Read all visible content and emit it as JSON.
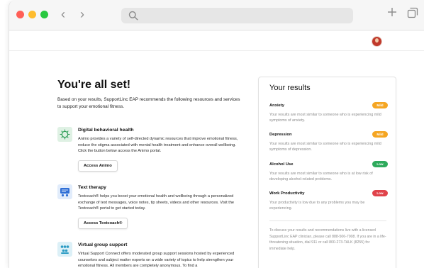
{
  "browser": {
    "icons": [
      "search-icon",
      "plus-icon",
      "tabs-icon",
      "back-icon",
      "forward-icon"
    ]
  },
  "main": {
    "title": "You're all set!",
    "intro": "Based on your results, SupportLinc EAP recommends the following resources and services to support your emotional fitness.",
    "resources": [
      {
        "title": "Digital behavioral health",
        "description": "Animo provides a variety of self-directed dynamic resources that improve emotional fitness, reduce the stigma associated with mental health treatment and enhance overall wellbeing. Click the button below access the Animo portal.",
        "button": "Access Animo",
        "icon": "brain-icon",
        "icon_bg": "#dff1e4",
        "icon_color": "#2e9d57"
      },
      {
        "title": "Text therapy",
        "description": "Textcoach® helps you boost your emotional health and wellbeing through a personalized exchange of text messages, voice notes, tip sheets, videos and other resources. Visit the Textcoach® portal to get started today.",
        "button": "Access Textcoach®",
        "icon": "chat-users-icon",
        "icon_bg": "#e1ecfb",
        "icon_color": "#2f6fd6"
      },
      {
        "title": "Virtual group support",
        "description": "Virtual Support Connect offers moderated group support sessions hosted by experienced counselors and subject matter experts on a wide variety of topics to help strengthen your emotional fitness. All members are completely anonymous. To find a",
        "icon": "group-icon",
        "icon_bg": "#dcf0f7",
        "icon_color": "#2b9bc4"
      }
    ]
  },
  "results": {
    "title": "Your results",
    "items": [
      {
        "name": "Anxiety",
        "badge": "Mild",
        "badge_bg": "#f5a623",
        "badge_fg": "#ffffff",
        "description": "Your results are most similar to someone who is experiencing mild symptoms of anxiety."
      },
      {
        "name": "Depression",
        "badge": "Mild",
        "badge_bg": "#f5a623",
        "badge_fg": "#ffffff",
        "description": "Your results are most similar to someone who is experiencing mild symptoms of depression."
      },
      {
        "name": "Alcohol Use",
        "badge": "Low",
        "badge_bg": "#2eaa5c",
        "badge_fg": "#ffffff",
        "description": "Your results are most similar to someone who is at low risk of developing alcohol-related problems."
      },
      {
        "name": "Work Productivity",
        "badge": "Low",
        "badge_bg": "#e0434b",
        "badge_fg": "#ffffff",
        "description": "Your productivity is low due to any problems you may be experiencing."
      }
    ],
    "note": "To discuss your results and recommendations live with a licensed SupportLinc EAP clinician, please call 888-506-7008. If you are in a life-threatening situation, dial 911 or call 800-273-TALK (8255) for immediate help."
  }
}
